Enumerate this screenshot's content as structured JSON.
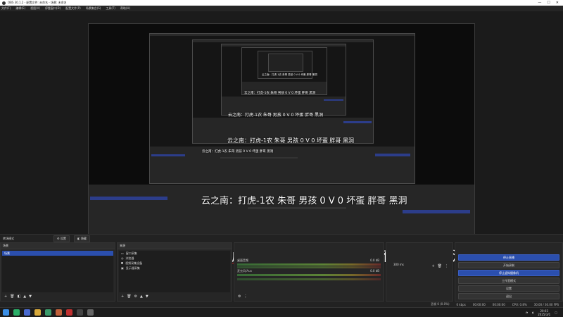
{
  "window": {
    "title": "OBS 30.1.2 - 配置文件: 未命名 - 场景: 未命名"
  },
  "menu": [
    "文件(F)",
    "编辑(E)",
    "视图(V)",
    "停靠窗口(D)",
    "配置文件(P)",
    "场景集合(S)",
    "工具(T)",
    "帮助(H)"
  ],
  "caption": "云之南：打虎-1农 朱哥 男孩 0 V 0 坏蛋 胖哥 黑洞",
  "scene_row": {
    "label": "转场模式",
    "settings_label": "设置",
    "hide_label": "隐藏"
  },
  "scenes": {
    "title": "场景",
    "items": [
      "场景"
    ]
  },
  "sources": {
    "title": "来源",
    "items": [
      "窗口采集",
      "浏览器",
      "视频采集设备",
      "显示器采集"
    ]
  },
  "mixer": {
    "tracks": [
      {
        "label": "桌面音频",
        "db": "0.0 dB"
      },
      {
        "label": "麦克风/Aux",
        "db": "0.0 dB"
      }
    ]
  },
  "transitions": {
    "duration": "300 ms"
  },
  "controls": {
    "buttons": [
      "停止直播",
      "开始录制",
      "停止虚拟摄像机",
      "工作室模式",
      "设置",
      "退出"
    ]
  },
  "status": {
    "dropped": "丢帧 0 (0.0%)",
    "kbps": "0 kbps",
    "live": "00:00:00",
    "rec": "00:00:00",
    "cpu": "CPU: 0.8%",
    "fps": "30.00 / 30.00 FPS"
  },
  "clock": {
    "time": "20:03",
    "date": "2025/3/1"
  },
  "taskbar_icons": [
    {
      "icon": "windows-icon",
      "color": "#3a8ee6"
    },
    {
      "icon": "wechat-icon",
      "color": "#2aae67"
    },
    {
      "icon": "app-icon",
      "color": "#4a6ad0"
    },
    {
      "icon": "folder-icon",
      "color": "#d8a93a"
    },
    {
      "icon": "chat-icon",
      "color": "#3a9a6a"
    },
    {
      "icon": "game-icon",
      "color": "#c0603a"
    },
    {
      "icon": "record-icon",
      "color": "#c03030"
    },
    {
      "icon": "obs-icon",
      "color": "#444444"
    },
    {
      "icon": "pin-icon",
      "color": "#666666"
    }
  ]
}
